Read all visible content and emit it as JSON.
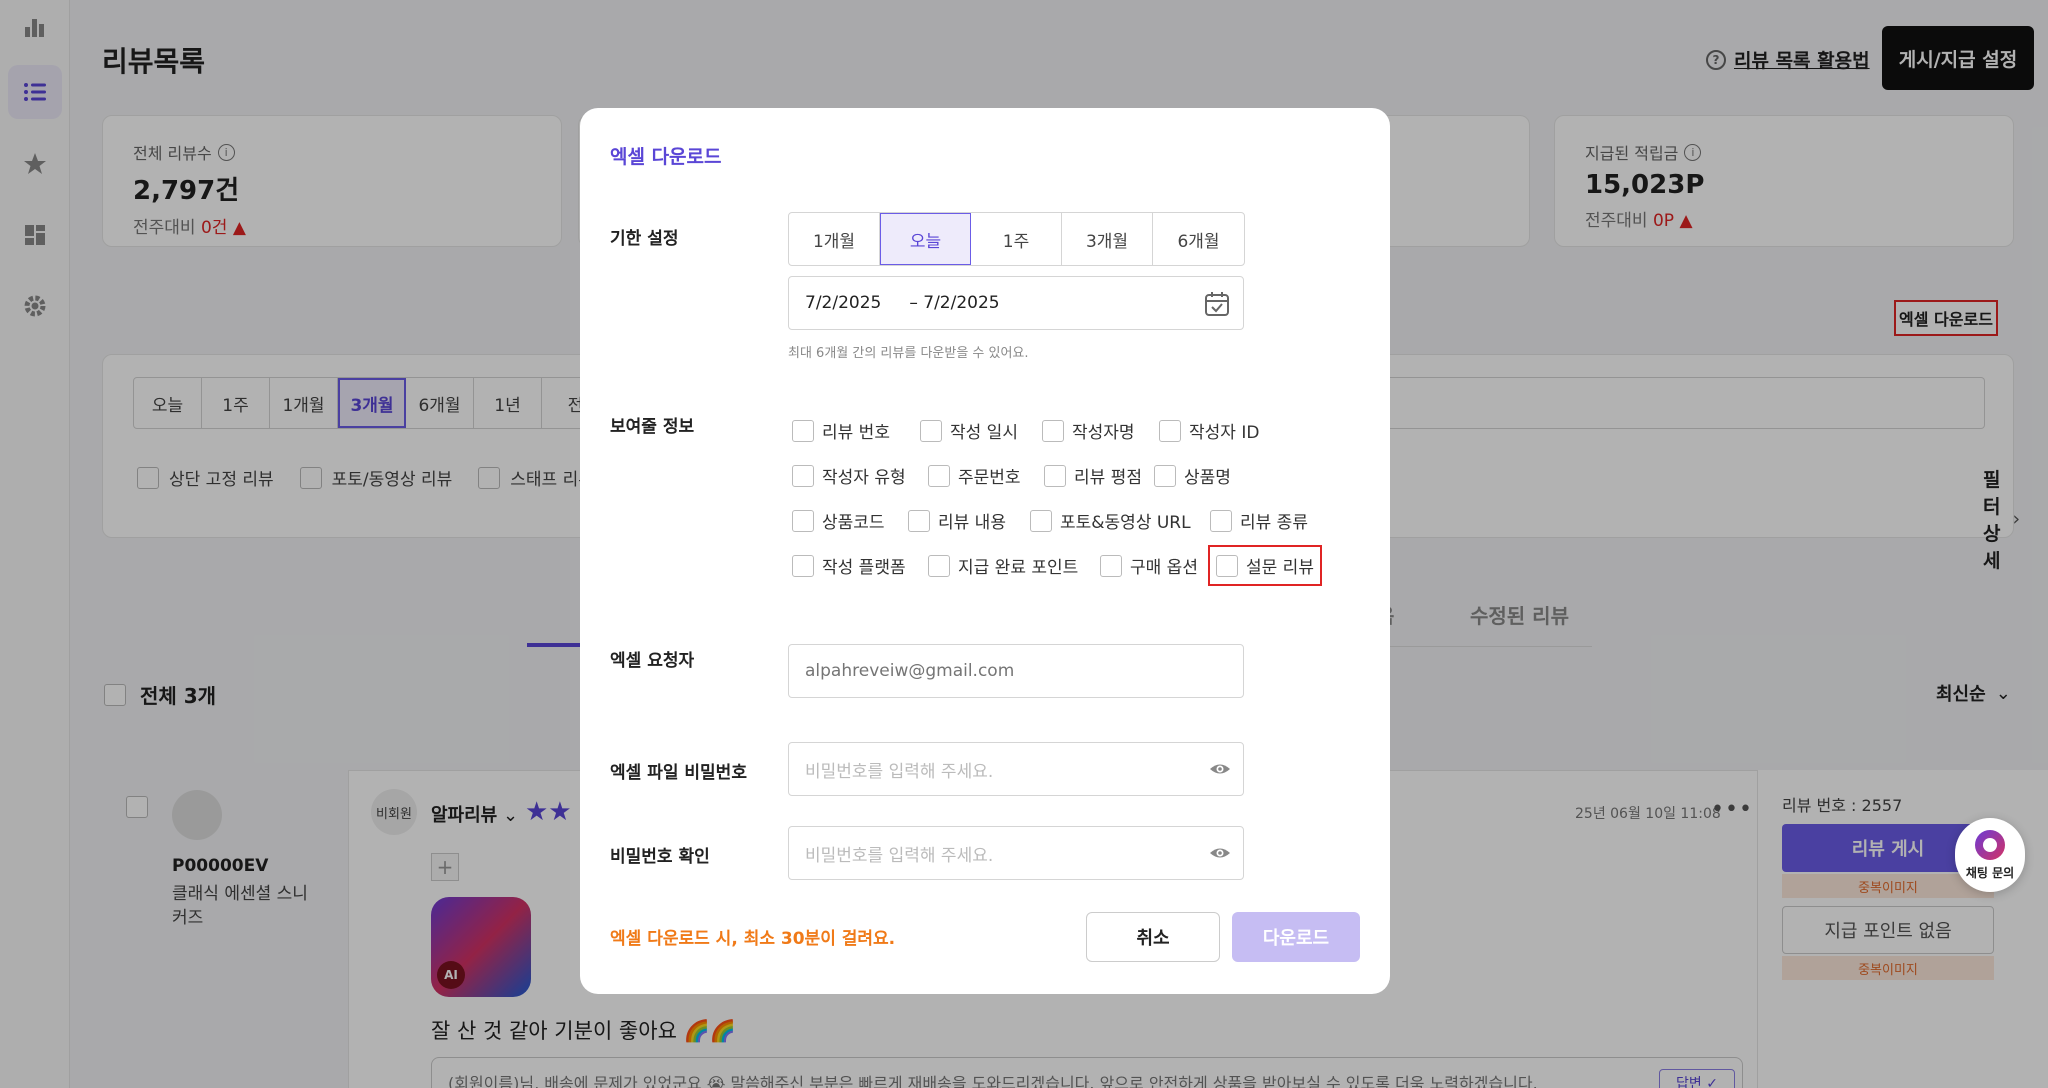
{
  "page": {
    "title": "리뷰목록",
    "help_link": "리뷰 목록 활용법",
    "settings_button": "게시/지급 설정",
    "excel_download": "엑셀 다운로드"
  },
  "stats": [
    {
      "label": "전체 리뷰수",
      "value": "2,797건",
      "diff_label": "전주대비",
      "diff_value": "0건"
    },
    {
      "label": "지급된 적립금",
      "value": "15,023P",
      "diff_label": "전주대비",
      "diff_value": "0P"
    }
  ],
  "filter": {
    "periods": [
      "오늘",
      "1주",
      "1개월",
      "3개월",
      "6개월",
      "1년",
      "전"
    ],
    "active_period": "3개월",
    "checks": [
      "상단 고정 리뷰",
      "포토/동영상 리뷰",
      "스태프 리뷰"
    ],
    "detail": "필터상세"
  },
  "tabs": {
    "partial": "음",
    "edited": "수정된 리뷰"
  },
  "list": {
    "total": "전체 3개",
    "sort": "최신순"
  },
  "review": {
    "product_code": "P00000EV",
    "product_name": "클래식 에센셜 스니커즈",
    "member_type": "비회원",
    "reviewer": "알파리뷰",
    "date": "25년 06월 10일 11:08",
    "more": "•••",
    "plus": "+",
    "ai_badge": "AI",
    "text": "잘 산 것 같아 기분이 좋아요 🌈🌈",
    "reply_preview": "(회원이름)님, 배송에 문제가 있었군요 😭 말씀해주신 부분은 빠르게 재배송을 도와드리겠습니다. 앞으로 안전하게 상품을 받아보실 수 있도록 더욱 노력하겠습니다.",
    "reply_tag": "답변 ✓",
    "number_label": "리뷰 번호 : 2557",
    "publish": "리뷰 게시",
    "dup_image": "중복이미지",
    "no_point": "지급 포인트 없음"
  },
  "chat": {
    "label": "채팅 문의"
  },
  "modal": {
    "title": "엑셀 다운로드",
    "period_label": "기한 설정",
    "periods": [
      "1개월",
      "오늘",
      "1주",
      "3개월",
      "6개월"
    ],
    "active_period": "오늘",
    "date_from": "7/2/2025",
    "date_to": "– 7/2/2025",
    "hint": "최대 6개월 간의 리뷰를 다운받을 수 있어요.",
    "info_label": "보여줄 정보",
    "fields": [
      [
        "리뷰 번호",
        "작성 일시",
        "작성자명",
        "작성자 ID"
      ],
      [
        "작성자 유형",
        "주문번호",
        "리뷰 평점",
        "상품명"
      ],
      [
        "상품코드",
        "리뷰 내용",
        "포토&동영상 URL",
        "리뷰 종류"
      ],
      [
        "작성 플랫폼",
        "지급 완료 포인트",
        "구매 옵션",
        "설문 리뷰"
      ]
    ],
    "requester_label": "엑셀 요청자",
    "requester_placeholder": "alpahreveiw@gmail.com",
    "password_label": "엑셀 파일 비밀번호",
    "password_placeholder": "비밀번호를 입력해 주세요.",
    "confirm_label": "비밀번호 확인",
    "confirm_placeholder": "비밀번호를 입력해 주세요.",
    "warning": "엑셀 다운로드 시, 최소 30분이 걸려요.",
    "cancel": "취소",
    "download": "다운로드"
  },
  "colors": {
    "accent": "#5a46d6",
    "warning": "#f07a18",
    "highlight": "#e02424"
  }
}
